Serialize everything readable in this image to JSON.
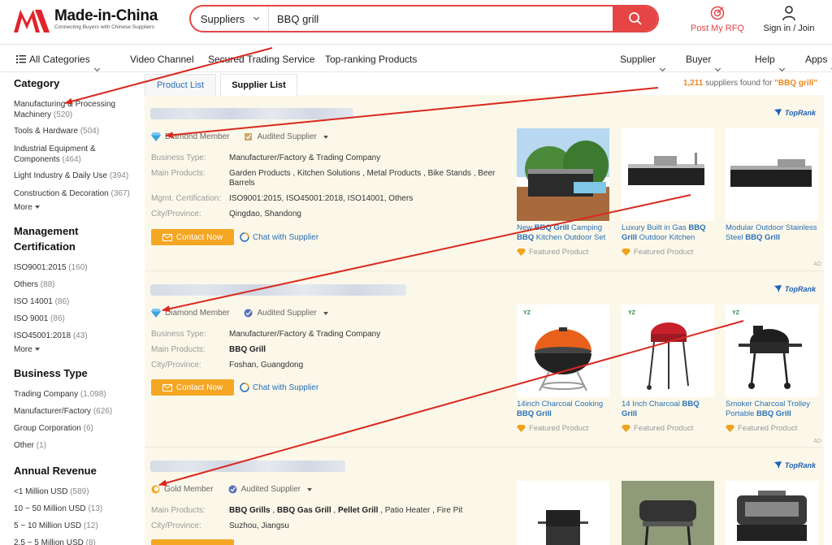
{
  "header": {
    "logo_title": "Made-in-China",
    "logo_sub": "Connecting Buyers with Chinese Suppliers",
    "search_type": "Suppliers",
    "search_value": "BBQ grill",
    "post_rfq": "Post My RFQ",
    "signin": "Sign in / Join"
  },
  "nav": {
    "all_categories": "All Categories",
    "video": "Video Channel",
    "secured": "Secured Trading Service",
    "top_ranking": "Top-ranking Products",
    "supplier": "Supplier",
    "buyer": "Buyer",
    "help": "Help",
    "apps": "Apps"
  },
  "sidebar": {
    "category_title": "Category",
    "categories": [
      {
        "label": "Manufacturing & Processing Machinery",
        "count": "(520)"
      },
      {
        "label": "Tools & Hardware",
        "count": "(504)"
      },
      {
        "label": "Industrial Equipment & Components",
        "count": "(464)"
      },
      {
        "label": "Light Industry & Daily Use",
        "count": "(394)"
      },
      {
        "label": "Construction & Decoration",
        "count": "(367)"
      }
    ],
    "more": "More",
    "cert_title_1": "Management",
    "cert_title_2": "Certification",
    "certs": [
      {
        "label": "ISO9001:2015",
        "count": "(160)"
      },
      {
        "label": "Others",
        "count": "(88)"
      },
      {
        "label": "ISO 14001",
        "count": "(86)"
      },
      {
        "label": "ISO 9001",
        "count": "(86)"
      },
      {
        "label": "ISO45001:2018",
        "count": "(43)"
      }
    ],
    "business_title": "Business Type",
    "business": [
      {
        "label": "Trading Company",
        "count": "(1,098)"
      },
      {
        "label": "Manufacturer/Factory",
        "count": "(626)"
      },
      {
        "label": "Group Corporation",
        "count": "(6)"
      },
      {
        "label": "Other",
        "count": "(1)"
      }
    ],
    "revenue_title": "Annual Revenue",
    "revenue": [
      {
        "label": "<1 Million USD",
        "count": "(589)"
      },
      {
        "label": "10 ~ 50 Million USD",
        "count": "(13)"
      },
      {
        "label": "5 ~ 10 Million USD",
        "count": "(12)"
      },
      {
        "label": "2.5 ~ 5 Million USD",
        "count": "(8)"
      }
    ]
  },
  "main": {
    "tab_product": "Product List",
    "tab_supplier": "Supplier List",
    "found_count": "1,211",
    "found_text": " suppliers found for ",
    "found_query": "\"BBQ grill\"",
    "toprank": "TopRank",
    "labels": {
      "business_type": "Business Type:",
      "main_products": "Main Products:",
      "mgmt_cert": "Mgmt. Certification:",
      "city": "City/Province:"
    },
    "contact": "Contact Now",
    "chat": "Chat with Supplier",
    "audited": "Audited Supplier",
    "featured": "Featured Product",
    "ad": "AD",
    "yz": "YZ",
    "suppliers": [
      {
        "member": "Diamond Member",
        "business_type": "Manufacturer/Factory & Trading Company",
        "main_products": "Garden Products , Kitchen Solutions , Metal Products , Bike Stands , Beer Barrels",
        "mgmt_cert": "ISO9001:2015, ISO45001:2018, ISO14001, Others",
        "city": "Qingdao, Shandong",
        "products": [
          {
            "title_a": "New ",
            "title_b": "BBQ Grill",
            "title_c": " Camping ",
            "title_d": "BBQ",
            "title_e": " Kitchen Outdoor Set"
          },
          {
            "title_a": "Luxury Built in Gas ",
            "title_b": "BBQ",
            "title_c": " ",
            "title_d": "Grill",
            "title_e": " Outdoor Kitchen"
          },
          {
            "title_a": "Modular Outdoor Stainless Steel ",
            "title_b": "BBQ Grill",
            "title_c": "",
            "title_d": "",
            "title_e": ""
          }
        ]
      },
      {
        "member": "Diamond Member",
        "business_type": "Manufacturer/Factory & Trading Company",
        "main_products": "BBQ Grill",
        "city": "Foshan, Guangdong",
        "products": [
          {
            "title_a": "14inch Charcoal Cooking ",
            "title_b": "BBQ Grill",
            "title_c": "",
            "title_d": "",
            "title_e": ""
          },
          {
            "title_a": "14 Inch Charcoal ",
            "title_b": "BBQ",
            "title_c": " ",
            "title_d": "Grill",
            "title_e": ""
          },
          {
            "title_a": "Smoker Charcoal Trolley Portable ",
            "title_b": "BBQ Grill",
            "title_c": "",
            "title_d": "",
            "title_e": ""
          }
        ]
      },
      {
        "member": "Gold Member",
        "mp_1": "BBQ Grills",
        "mp_2": " , ",
        "mp_3": "BBQ Gas Grill",
        "mp_4": " , ",
        "mp_5": "Pellet Grill",
        "mp_6": " , Patio Heater , Fire Pit",
        "city": "Suzhou, Jiangsu"
      }
    ]
  },
  "colors": {
    "brand_red": "#e64545",
    "contact_orange": "#f5a623",
    "link_blue": "#2a6fb5",
    "arrow_red": "#d9281e"
  },
  "icons": [
    "hamburger-icon",
    "search-icon",
    "rfq-icon",
    "user-icon",
    "diamond-icon",
    "audited-icon",
    "mail-icon",
    "chat-icon",
    "gold-icon",
    "toprank-icon"
  ]
}
